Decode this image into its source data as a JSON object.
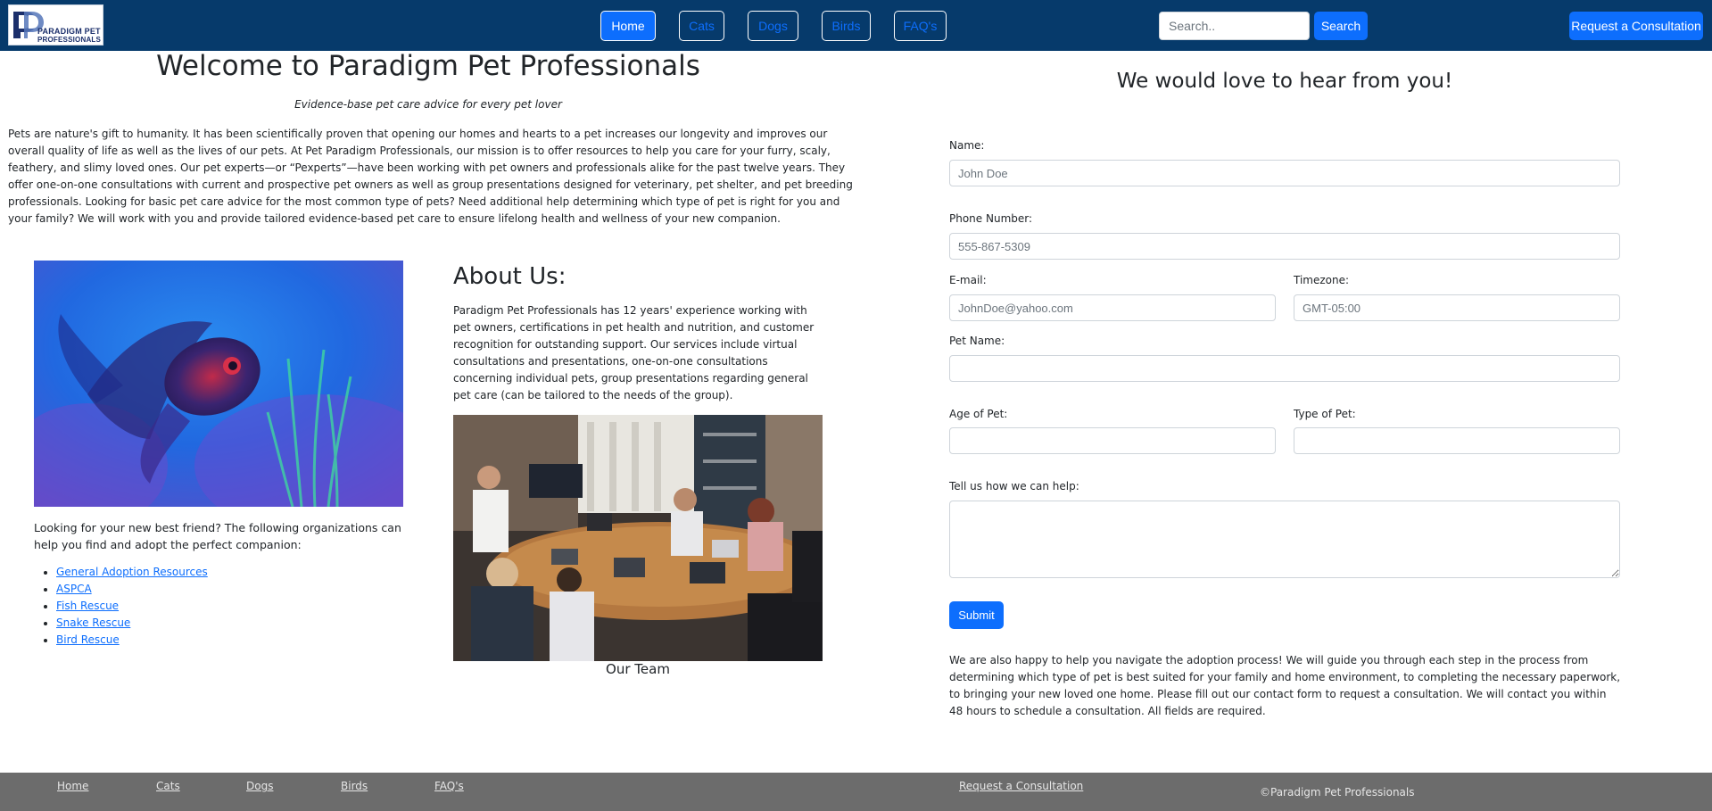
{
  "nav": {
    "logo": {
      "text_line1": "PARADIGM PET",
      "text_line2": "PROFESSIONALS"
    },
    "links": [
      "Home",
      "Cats",
      "Dogs",
      "Birds",
      "FAQ's"
    ],
    "active": "Home",
    "search": {
      "placeholder": "Search..",
      "button": "Search"
    },
    "consult_button": "Request a Consultation"
  },
  "hero": {
    "title": "Welcome to Paradigm Pet Professionals",
    "tagline": "Evidence-base pet care advice for every pet lover",
    "intro": "Pets are nature's gift to humanity. It has been scientifically proven that opening our homes and hearts to a pet increases our longevity and improves our overall quality of life as well as the lives of our pets. At Pet Paradigm Professionals, our mission is to offer resources to help you care for your furry, scaly, feathery, and slimy loved ones. Our pet experts—or “Pexperts”—have been working with pet owners and professionals alike for the past twelve years. They offer one-on-one consultations with current and prospective pet owners as well as group presentations designed for veterinary, pet shelter, and pet breeding professionals. Looking for basic pet care advice for the most common type of pets? Need additional help determining which type of pet is right for you and your family? We will work with you and provide tailored evidence-based pet care to ensure lifelong health and wellness of your new companion."
  },
  "adoption": {
    "text": "Looking for your new best friend? The following organizations can help you find and adopt the perfect companion:",
    "links": [
      "General Adoption Resources",
      "ASPCA",
      "Fish Rescue",
      "Snake Rescue",
      "Bird Rescue"
    ]
  },
  "about": {
    "title": "About Us:",
    "text": "Paradigm Pet Professionals has 12 years' experience working with pet owners, certifications in pet health and nutrition, and customer recognition for outstanding support. Our services include virtual consultations and presentations, one-on-one consultations concerning individual pets, group presentations regarding general pet care (can be tailored to the needs of the group).",
    "caption": "Our Team"
  },
  "form": {
    "title": "We would love to hear from you!",
    "name": {
      "label": "Name:",
      "placeholder": "John Doe"
    },
    "phone": {
      "label": "Phone Number:",
      "placeholder": "555-867-5309"
    },
    "email": {
      "label": "E-mail:",
      "placeholder": "JohnDoe@yahoo.com"
    },
    "timezone": {
      "label": "Timezone:",
      "placeholder": "GMT-05:00"
    },
    "pet_name": {
      "label": "Pet Name:",
      "placeholder": ""
    },
    "pet_age": {
      "label": "Age of Pet:",
      "placeholder": ""
    },
    "pet_type": {
      "label": "Type of Pet:",
      "placeholder": ""
    },
    "help": {
      "label": "Tell us how we can help:",
      "placeholder": ""
    },
    "submit": "Submit",
    "note": "We are also happy to help you navigate the adoption process! We will guide you through each step in the process from determining which type of pet is best suited for your family and home environment, to completing the necessary paperwork, to bringing your new loved one home. Please fill out our contact form to request a consultation. We will contact you within 48 hours to schedule a consultation. All fields are required."
  },
  "footer": {
    "links": [
      "Home",
      "Cats",
      "Dogs",
      "Birds",
      "FAQ's"
    ],
    "consult_link": "Request a Consultation",
    "copyright": "©Paradigm Pet Professionals"
  },
  "colors": {
    "navbar": "#063a6b",
    "primary": "#0d6efd",
    "footer": "#6c6c6c"
  },
  "icons": {
    "logo": "paradigm-pet-logo-icon"
  }
}
